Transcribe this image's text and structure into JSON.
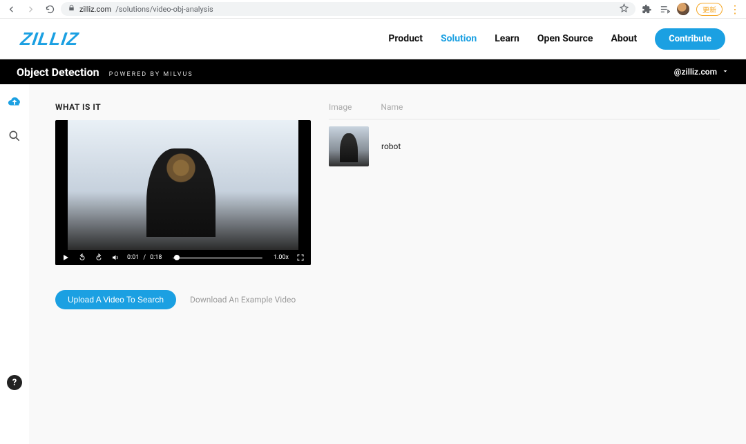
{
  "browser": {
    "url_host": "zilliz.com",
    "url_path": "/solutions/video-obj-analysis",
    "update_label": "更新"
  },
  "header": {
    "logo_text": "ZILLIZ",
    "nav": {
      "product": "Product",
      "solution": "Solution",
      "learn": "Learn",
      "open_source": "Open Source",
      "about": "About"
    },
    "contribute": "Contribute"
  },
  "subheader": {
    "title": "Object Detection",
    "subtitle": "POWERED BY MILVUS",
    "handle": "@zilliz.com"
  },
  "sidebar": {
    "help_label": "?"
  },
  "content": {
    "section_title": "WHAT IS IT",
    "video": {
      "current_time": "0:01",
      "separator": "/",
      "duration": "0:18",
      "speed": "1.00x"
    },
    "actions": {
      "upload": "Upload A Video To Search",
      "download": "Download An Example Video"
    },
    "results": {
      "headers": {
        "image": "Image",
        "name": "Name"
      },
      "rows": [
        {
          "name": "robot"
        }
      ]
    }
  }
}
